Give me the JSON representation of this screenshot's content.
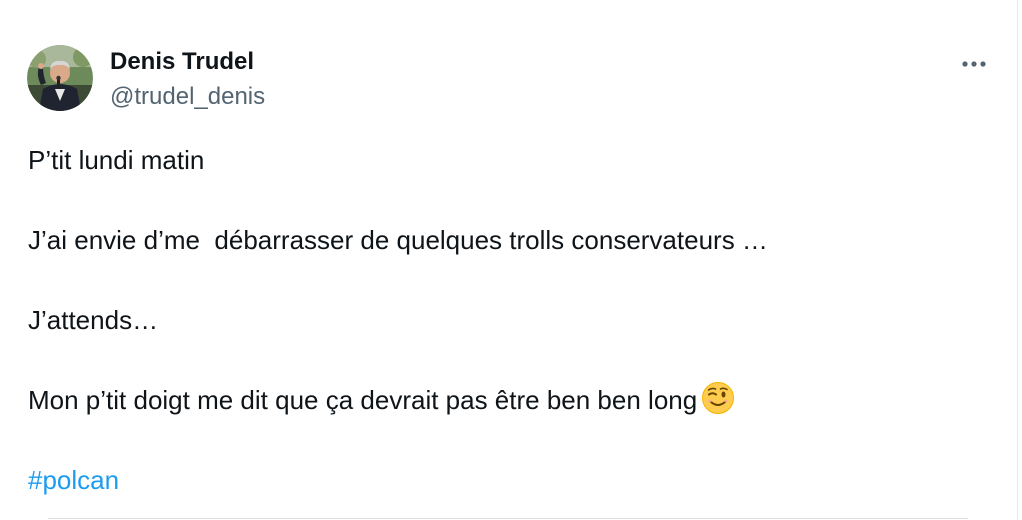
{
  "author": {
    "name": "Denis Trudel",
    "handle": "@trudel_denis"
  },
  "menu": {
    "more_icon": "more-horizontal-icon"
  },
  "tweet": {
    "line1": "P’tit lundi matin",
    "line2": "J’ai envie d’me  débarrasser de quelques trolls conservateurs …",
    "line3": "J’attends…",
    "line4": "Mon p’tit doigt me dit que ça devrait pas être ben ben long",
    "emoji": "winking-face-icon",
    "hashtag": "#polcan"
  },
  "colors": {
    "text": "#0f1419",
    "secondary": "#536471",
    "link": "#1d9bf0"
  }
}
